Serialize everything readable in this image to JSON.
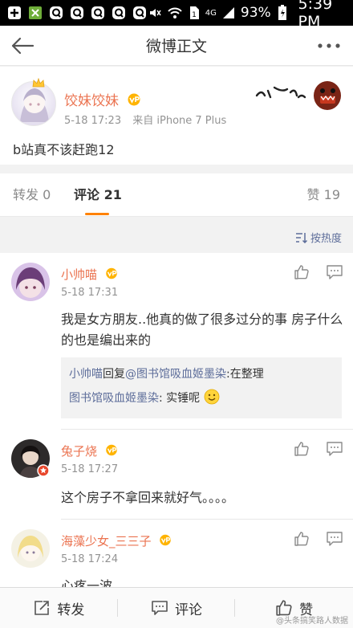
{
  "statusbar": {
    "network": "4G",
    "battery": "93%",
    "time": "5:39 PM"
  },
  "nav": {
    "title": "微博正文"
  },
  "post": {
    "author": "饺妹饺妹",
    "time": "5-18 17:23",
    "source": "来自 iPhone 7 Plus",
    "text": "b站真不该赶跑12"
  },
  "tabs": {
    "repost_label": "转发",
    "repost_count": "0",
    "comment_label": "评论",
    "comment_count": "21",
    "like_label": "赞",
    "like_count": "19"
  },
  "sort": {
    "label": "按热度"
  },
  "comments": [
    {
      "name": "小帅喵",
      "time": "5-18 17:31",
      "text": "我是女方朋友..他真的做了很多过分的事 房子什么的也是编出来的",
      "replies": [
        {
          "author": "小帅喵",
          "action": "回复",
          "target": "@图书馆吸血姬墨染",
          "text": ":在整理"
        },
        {
          "author": "图书馆吸血姬墨染",
          "text": ": 实锤呢"
        }
      ]
    },
    {
      "name": "兔子烧",
      "time": "5-18 17:27",
      "text": "这个房子不拿回来就好气。。。。"
    },
    {
      "name": "海藻少女_三三子",
      "time": "5-18 17:24",
      "text": "心疼一波"
    }
  ],
  "bottombar": {
    "repost": "转发",
    "comment": "评论",
    "like": "赞"
  },
  "watermark": "@头条搞笑路人数据",
  "colors": {
    "accent_orange": "#ff8200",
    "name_orange": "#eb7350",
    "link_blue": "#5d6d9a",
    "meta_gray": "#939393"
  }
}
